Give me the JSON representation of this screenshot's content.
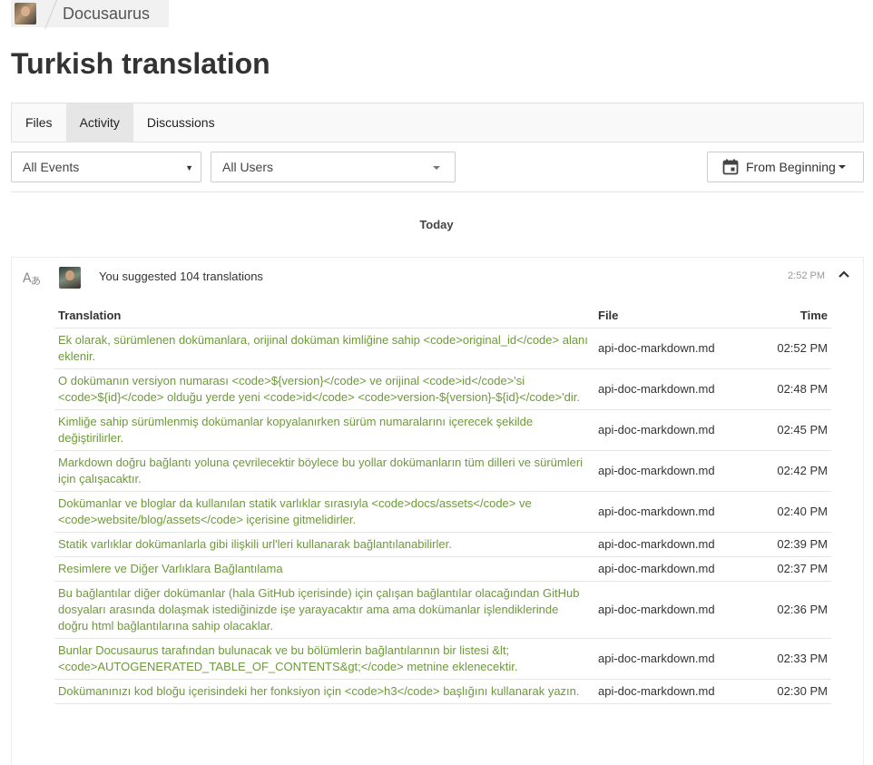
{
  "breadcrumb": {
    "project": "Docusaurus"
  },
  "page": {
    "title": "Turkish translation"
  },
  "tabs": [
    {
      "label": "Files",
      "active": false
    },
    {
      "label": "Activity",
      "active": true
    },
    {
      "label": "Discussions",
      "active": false
    }
  ],
  "filters": {
    "events": "All Events",
    "users": "All Users",
    "date": "From Beginning"
  },
  "feed": {
    "day": "Today",
    "entry": {
      "summary": "You suggested 104 translations",
      "time": "2:52 PM",
      "columns": {
        "translation": "Translation",
        "file": "File",
        "time": "Time"
      },
      "rows": [
        {
          "text": "Ek olarak, sürümlenen dokümanlara, orijinal doküman kimliğine sahip <code>original_id</code> alanı eklenir.",
          "file": "api-doc-markdown.md",
          "time": "02:52 PM"
        },
        {
          "text": "O dokümanın versiyon numarası <code>${version}</code> ve orijinal <code>id</code>'si <code>${id}</code> olduğu yerde yeni <code>id</code> <code>version-${version}-${id}</code>'dir.",
          "file": "api-doc-markdown.md",
          "time": "02:48 PM"
        },
        {
          "text": "Kimliğe sahip sürümlenmiş dokümanlar kopyalanırken sürüm numaralarını içerecek şekilde değiştirilirler.",
          "file": "api-doc-markdown.md",
          "time": "02:45 PM"
        },
        {
          "text": "Markdown doğru bağlantı yoluna çevrilecektir böylece bu yollar dokümanların tüm dilleri ve sürümleri için çalışacaktır.",
          "file": "api-doc-markdown.md",
          "time": "02:42 PM"
        },
        {
          "text": "Dokümanlar ve bloglar da kullanılan statik varlıklar sırasıyla <code>docs/assets</code> ve <code>website/blog/assets</code> içerisine gitmelidirler.",
          "file": "api-doc-markdown.md",
          "time": "02:40 PM"
        },
        {
          "text": "Statik varlıklar dokümanlarla gibi ilişkili url'leri kullanarak bağlantılanabilirler.",
          "file": "api-doc-markdown.md",
          "time": "02:39 PM"
        },
        {
          "text": "Resimlere ve Diğer Varlıklara Bağlantılama",
          "file": "api-doc-markdown.md",
          "time": "02:37 PM"
        },
        {
          "text": "Bu bağlantılar diğer dokümanlar (hala GitHub içerisinde) için çalışan bağlantılar olacağından GitHub dosyaları arasında dolaşmak istediğinizde işe yarayacaktır ama ama dokümanlar işlendiklerinde doğru html bağlantılarına sahip olacaklar.",
          "file": "api-doc-markdown.md",
          "time": "02:36 PM"
        },
        {
          "text": "Bunlar Docusaurus tarafından bulunacak ve bu bölümlerin bağlantılarının bir listesi &lt;<code>AUTOGENERATED_TABLE_OF_CONTENTS&gt;</code> metnine eklenecektir.",
          "file": "api-doc-markdown.md",
          "time": "02:33 PM"
        },
        {
          "text": "Dokümanınızı kod bloğu içerisindeki her fonksiyon için <code>h3</code> başlığını kullanarak yazın.",
          "file": "api-doc-markdown.md",
          "time": "02:30 PM"
        }
      ]
    }
  },
  "icons": {
    "project_avatar": "user-avatar",
    "calendar": "calendar-icon",
    "translate": "translate-icon",
    "collapse": "chevron-up-icon"
  },
  "colors": {
    "translation_text": "#6d9a3a",
    "active_tab": "#e6e6e6"
  }
}
